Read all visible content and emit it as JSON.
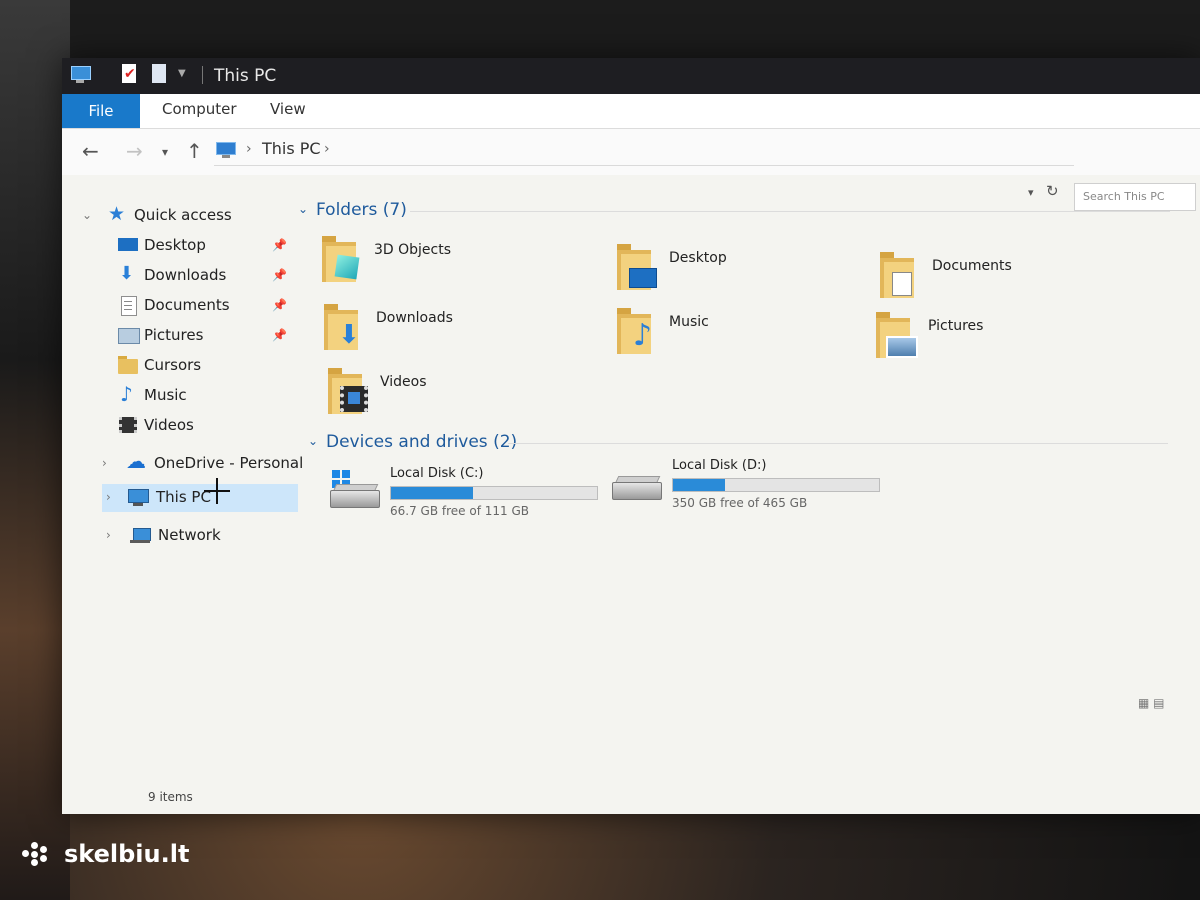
{
  "window": {
    "title": "This PC",
    "ribbon_tabs": [
      "File",
      "Computer",
      "View"
    ]
  },
  "address": {
    "path": "This PC",
    "search_placeholder": "Search This PC"
  },
  "nav": {
    "quick_access": "Quick access",
    "items": [
      {
        "label": "Desktop",
        "icon": "desktop-icon",
        "pinned": true
      },
      {
        "label": "Downloads",
        "icon": "downloads-icon",
        "pinned": true
      },
      {
        "label": "Documents",
        "icon": "documents-icon",
        "pinned": true
      },
      {
        "label": "Pictures",
        "icon": "pictures-icon",
        "pinned": true
      },
      {
        "label": "Cursors",
        "icon": "folder-icon",
        "pinned": false
      },
      {
        "label": "Music",
        "icon": "music-icon",
        "pinned": false
      },
      {
        "label": "Videos",
        "icon": "videos-icon",
        "pinned": false
      }
    ],
    "onedrive": "OneDrive - Personal",
    "this_pc": "This PC",
    "network": "Network"
  },
  "folders": {
    "header": "Folders (7)",
    "items": [
      {
        "label": "3D Objects",
        "icon": "3d-objects-icon"
      },
      {
        "label": "Desktop",
        "icon": "desktop-folder-icon"
      },
      {
        "label": "Documents",
        "icon": "documents-folder-icon"
      },
      {
        "label": "Downloads",
        "icon": "downloads-folder-icon"
      },
      {
        "label": "Music",
        "icon": "music-folder-icon"
      },
      {
        "label": "Pictures",
        "icon": "pictures-folder-icon"
      },
      {
        "label": "Videos",
        "icon": "videos-folder-icon"
      }
    ]
  },
  "drives": {
    "header": "Devices and drives (2)",
    "items": [
      {
        "name": "Local Disk (C:)",
        "free": "66.7 GB free of 111 GB",
        "used_fraction": 0.4
      },
      {
        "name": "Local Disk (D:)",
        "free": "350 GB free of 465 GB",
        "used_fraction": 0.25
      }
    ]
  },
  "status": {
    "items_count": "9 items"
  },
  "watermark": "skelbiu.lt",
  "colors": {
    "accent": "#1979ca",
    "selection": "#cde6fa",
    "group_header": "#1e5a9c",
    "drive_bar": "#2a8bd8",
    "folder": "#e2b659"
  }
}
